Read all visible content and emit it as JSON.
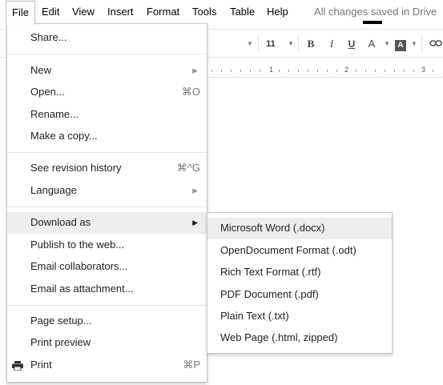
{
  "menubar": {
    "items": [
      {
        "label": "File"
      },
      {
        "label": "Edit"
      },
      {
        "label": "View"
      },
      {
        "label": "Insert"
      },
      {
        "label": "Format"
      },
      {
        "label": "Tools"
      },
      {
        "label": "Table"
      },
      {
        "label": "Help"
      }
    ],
    "status": "All changes saved in Drive"
  },
  "toolbar": {
    "font_size": "11",
    "bold": "B",
    "italic": "I",
    "underline": "U",
    "text_color": "A",
    "highlight": "A",
    "text_color_value": "#000000"
  },
  "ruler": {
    "numbers": [
      "1",
      "2",
      "3"
    ]
  },
  "file_menu": {
    "sections": [
      [
        {
          "label": "Share..."
        }
      ],
      [
        {
          "label": "New",
          "submenu": true
        },
        {
          "label": "Open...",
          "shortcut": "⌘O"
        },
        {
          "label": "Rename..."
        },
        {
          "label": "Make a copy..."
        }
      ],
      [
        {
          "label": "See revision history",
          "shortcut": "⌘^G"
        },
        {
          "label": "Language",
          "submenu": true
        }
      ],
      [
        {
          "label": "Download as",
          "submenu": true,
          "highlighted": true
        },
        {
          "label": "Publish to the web..."
        },
        {
          "label": "Email collaborators..."
        },
        {
          "label": "Email as attachment..."
        }
      ],
      [
        {
          "label": "Page setup..."
        },
        {
          "label": "Print preview"
        },
        {
          "label": "Print",
          "shortcut": "⌘P",
          "icon": "printer-icon"
        }
      ]
    ]
  },
  "download_submenu": {
    "items": [
      {
        "label": "Microsoft Word (.docx)",
        "highlighted": true
      },
      {
        "label": "OpenDocument Format (.odt)"
      },
      {
        "label": "Rich Text Format (.rtf)"
      },
      {
        "label": "PDF Document (.pdf)"
      },
      {
        "label": "Plain Text (.txt)"
      },
      {
        "label": "Web Page (.html, zipped)"
      }
    ]
  },
  "colors": {
    "menu_highlight": "#eeeeee",
    "menu_border": "#c6c6c6",
    "status_text": "#777777"
  }
}
